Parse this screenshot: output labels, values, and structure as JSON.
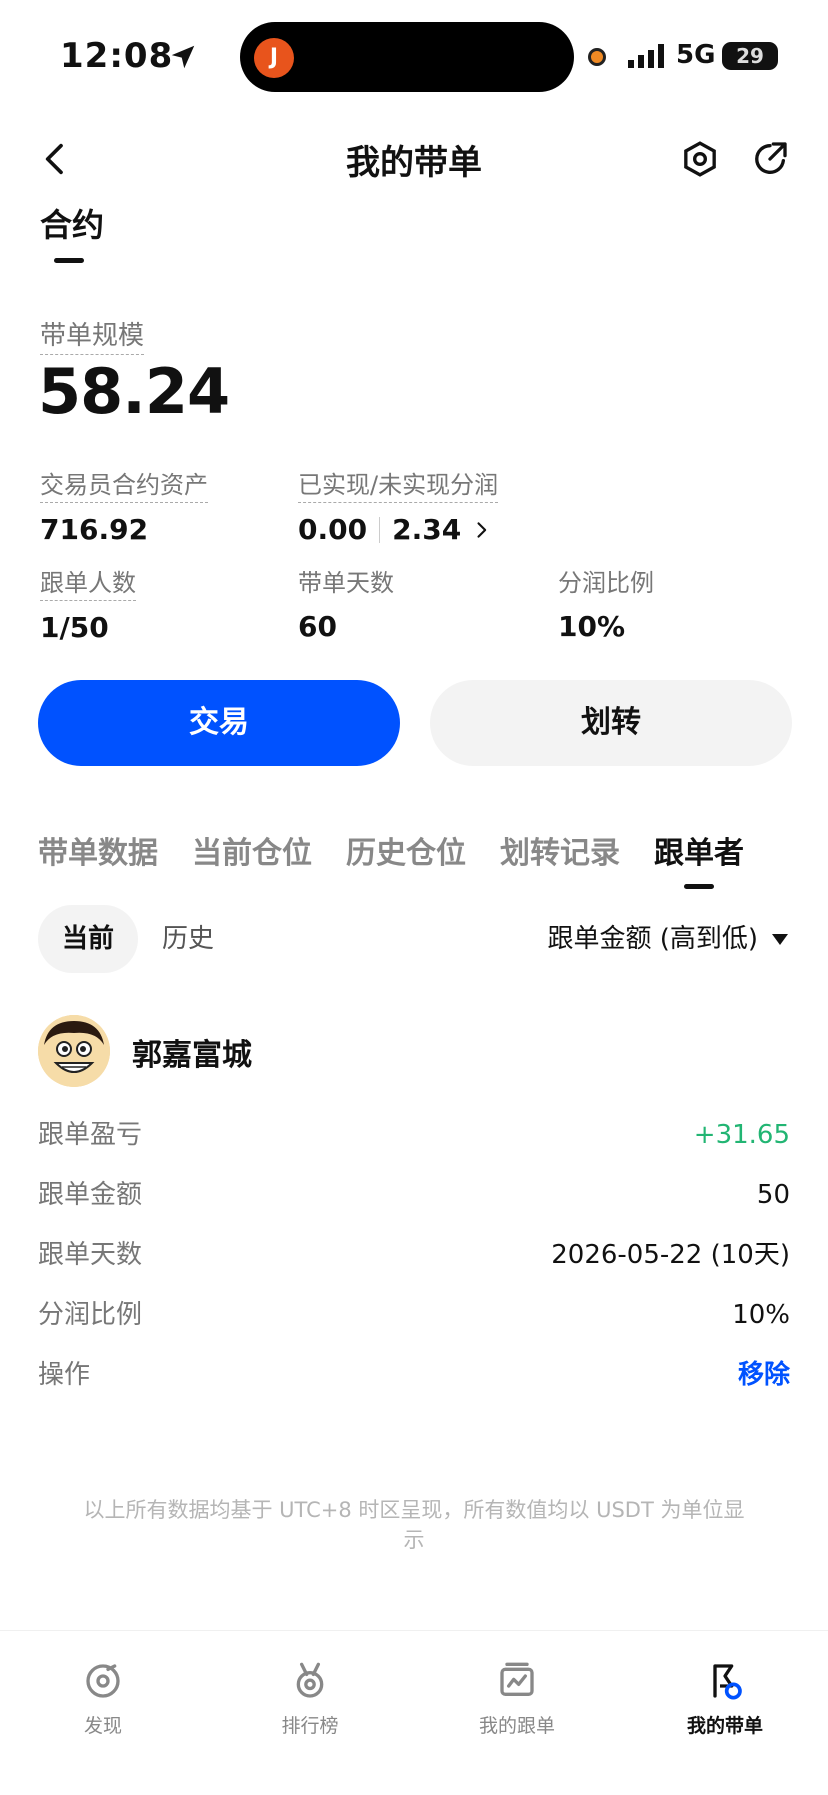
{
  "status_bar": {
    "time": "12:08",
    "network": "5G",
    "battery": "29",
    "island_app_letter": "J"
  },
  "header": {
    "title": "我的带单"
  },
  "section_tab": "合约",
  "scale": {
    "label": "带单规模",
    "value": "58.24"
  },
  "stats": {
    "assets_label": "交易员合约资产",
    "assets_value": "716.92",
    "pnl_label": "已实现/未实现分润",
    "realized": "0.00",
    "unrealized": "2.34",
    "followers_label": "跟单人数",
    "followers_value": "1/50",
    "days_label": "带单天数",
    "days_value": "60",
    "share_label": "分润比例",
    "share_value": "10%"
  },
  "buttons": {
    "trade": "交易",
    "transfer": "划转"
  },
  "tabs": [
    "带单数据",
    "当前仓位",
    "历史仓位",
    "划转记录",
    "跟单者"
  ],
  "segment": {
    "current": "当前",
    "history": "历史",
    "sort": "跟单金额 (高到低)"
  },
  "follower": {
    "name": "郭嘉富城",
    "rows": [
      {
        "k": "跟单盈亏",
        "v": "+31.65"
      },
      {
        "k": "跟单金额",
        "v": "50"
      },
      {
        "k": "跟单天数",
        "v": "2026-05-22 (10天)"
      },
      {
        "k": "分润比例",
        "v": "10%"
      },
      {
        "k": "操作",
        "v": "移除"
      }
    ]
  },
  "footnote": "以上所有数据均基于 UTC+8 时区呈现，所有数值均以 USDT 为单位显示",
  "bottom_nav": [
    "发现",
    "排行榜",
    "我的跟单",
    "我的带单"
  ],
  "colors": {
    "primary": "#0052ff",
    "profit": "#22b573"
  }
}
